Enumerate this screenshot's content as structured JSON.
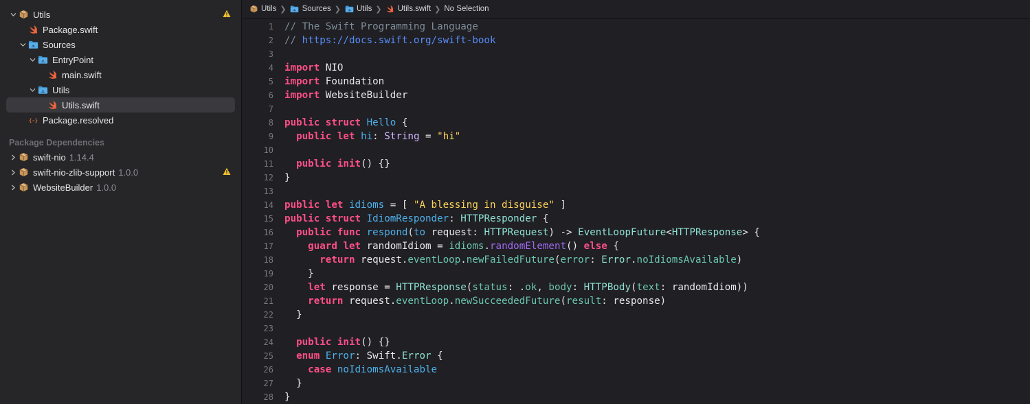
{
  "navigator": {
    "items": [
      {
        "label": "Utils",
        "icon": "package-icon",
        "indent": 0,
        "chevron": "down",
        "warning": true,
        "name": "utils-package"
      },
      {
        "label": "Package.swift",
        "icon": "swift-file-icon",
        "indent": 1,
        "chevron": "none",
        "name": "package-swift-file"
      },
      {
        "label": "Sources",
        "icon": "folder-icon",
        "indent": 1,
        "chevron": "down",
        "name": "sources-folder"
      },
      {
        "label": "EntryPoint",
        "icon": "folder-icon",
        "indent": 2,
        "chevron": "down",
        "name": "entrypoint-folder"
      },
      {
        "label": "main.swift",
        "icon": "swift-file-icon",
        "indent": 3,
        "chevron": "none",
        "name": "main-swift-file"
      },
      {
        "label": "Utils",
        "icon": "folder-icon",
        "indent": 2,
        "chevron": "down",
        "name": "utils-folder"
      },
      {
        "label": "Utils.swift",
        "icon": "swift-file-icon",
        "indent": 3,
        "chevron": "none",
        "selected": true,
        "name": "utils-swift-file"
      },
      {
        "label": "Package.resolved",
        "icon": "resolved-file-icon",
        "indent": 1,
        "chevron": "none",
        "name": "package-resolved-file"
      }
    ],
    "dependencies_header": "Package Dependencies",
    "dependencies": [
      {
        "label": "swift-nio",
        "version": "1.14.4",
        "warning": false
      },
      {
        "label": "swift-nio-zlib-support",
        "version": "1.0.0",
        "warning": true
      },
      {
        "label": "WebsiteBuilder",
        "version": "1.0.0",
        "warning": false
      }
    ]
  },
  "jumpbar": {
    "crumbs": [
      {
        "label": "Utils",
        "icon": "package-icon"
      },
      {
        "label": "Sources",
        "icon": "folder-icon"
      },
      {
        "label": "Utils",
        "icon": "folder-icon"
      },
      {
        "label": "Utils.swift",
        "icon": "swift-file-icon"
      },
      {
        "label": "No Selection",
        "icon": ""
      }
    ],
    "separator": "❯"
  },
  "editor": {
    "lines": [
      [
        [
          "cm",
          "// The Swift Programming Language"
        ]
      ],
      [
        [
          "cm",
          "// "
        ],
        [
          "url",
          "https://docs.swift.org/swift-book"
        ]
      ],
      [],
      [
        [
          "kw",
          "import"
        ],
        [
          "pun",
          " NIO"
        ]
      ],
      [
        [
          "kw",
          "import"
        ],
        [
          "pun",
          " Foundation"
        ]
      ],
      [
        [
          "kw",
          "import"
        ],
        [
          "pun",
          " WebsiteBuilder"
        ]
      ],
      [],
      [
        [
          "kw",
          "public"
        ],
        [
          "pun",
          " "
        ],
        [
          "kw",
          "struct"
        ],
        [
          "pun",
          " "
        ],
        [
          "decl",
          "Hello"
        ],
        [
          "pun",
          " {"
        ]
      ],
      [
        [
          "pun",
          "  "
        ],
        [
          "kw",
          "public"
        ],
        [
          "pun",
          " "
        ],
        [
          "kw",
          "let"
        ],
        [
          "pun",
          " "
        ],
        [
          "decl",
          "hi"
        ],
        [
          "pun",
          ": "
        ],
        [
          "typ",
          "String"
        ],
        [
          "pun",
          " = "
        ],
        [
          "str",
          "\"hi\""
        ]
      ],
      [],
      [
        [
          "pun",
          "  "
        ],
        [
          "kw",
          "public"
        ],
        [
          "pun",
          " "
        ],
        [
          "kw",
          "init"
        ],
        [
          "pun",
          "() {}"
        ]
      ],
      [
        [
          "pun",
          "}"
        ]
      ],
      [],
      [
        [
          "kw",
          "public"
        ],
        [
          "pun",
          " "
        ],
        [
          "kw",
          "let"
        ],
        [
          "pun",
          " "
        ],
        [
          "decl",
          "idioms"
        ],
        [
          "pun",
          " = [ "
        ],
        [
          "str",
          "\"A blessing in disguise\""
        ],
        [
          "pun",
          " ]"
        ]
      ],
      [
        [
          "kw",
          "public"
        ],
        [
          "pun",
          " "
        ],
        [
          "kw",
          "struct"
        ],
        [
          "pun",
          " "
        ],
        [
          "decl",
          "IdiomResponder"
        ],
        [
          "pun",
          ": "
        ],
        [
          "lib",
          "HTTPResponder"
        ],
        [
          "pun",
          " {"
        ]
      ],
      [
        [
          "pun",
          "  "
        ],
        [
          "kw",
          "public"
        ],
        [
          "pun",
          " "
        ],
        [
          "kw",
          "func"
        ],
        [
          "pun",
          " "
        ],
        [
          "decl",
          "respond"
        ],
        [
          "pun",
          "("
        ],
        [
          "decl",
          "to"
        ],
        [
          "pun",
          " request: "
        ],
        [
          "lib",
          "HTTPRequest"
        ],
        [
          "pun",
          ") -> "
        ],
        [
          "lib",
          "EventLoopFuture"
        ],
        [
          "pun",
          "<"
        ],
        [
          "lib",
          "HTTPResponse"
        ],
        [
          "pun",
          "> {"
        ]
      ],
      [
        [
          "pun",
          "    "
        ],
        [
          "kw",
          "guard"
        ],
        [
          "pun",
          " "
        ],
        [
          "kw",
          "let"
        ],
        [
          "pun",
          " randomIdiom = "
        ],
        [
          "mem",
          "idioms"
        ],
        [
          "pun",
          "."
        ],
        [
          "meth",
          "randomElement"
        ],
        [
          "pun",
          "() "
        ],
        [
          "kw",
          "else"
        ],
        [
          "pun",
          " {"
        ]
      ],
      [
        [
          "pun",
          "      "
        ],
        [
          "kw",
          "return"
        ],
        [
          "pun",
          " request."
        ],
        [
          "mem",
          "eventLoop"
        ],
        [
          "pun",
          "."
        ],
        [
          "mem",
          "newFailedFuture"
        ],
        [
          "pun",
          "("
        ],
        [
          "mem",
          "error"
        ],
        [
          "pun",
          ": "
        ],
        [
          "lib",
          "Error"
        ],
        [
          "pun",
          "."
        ],
        [
          "mem",
          "noIdiomsAvailable"
        ],
        [
          "pun",
          ")"
        ]
      ],
      [
        [
          "pun",
          "    }"
        ]
      ],
      [
        [
          "pun",
          "    "
        ],
        [
          "kw",
          "let"
        ],
        [
          "pun",
          " response = "
        ],
        [
          "lib",
          "HTTPResponse"
        ],
        [
          "pun",
          "("
        ],
        [
          "mem",
          "status"
        ],
        [
          "pun",
          ": ."
        ],
        [
          "mem",
          "ok"
        ],
        [
          "pun",
          ", "
        ],
        [
          "mem",
          "body"
        ],
        [
          "pun",
          ": "
        ],
        [
          "lib",
          "HTTPBody"
        ],
        [
          "pun",
          "("
        ],
        [
          "mem",
          "text"
        ],
        [
          "pun",
          ": randomIdiom))"
        ]
      ],
      [
        [
          "pun",
          "    "
        ],
        [
          "kw",
          "return"
        ],
        [
          "pun",
          " request."
        ],
        [
          "mem",
          "eventLoop"
        ],
        [
          "pun",
          "."
        ],
        [
          "mem",
          "newSucceededFuture"
        ],
        [
          "pun",
          "("
        ],
        [
          "mem",
          "result"
        ],
        [
          "pun",
          ": response)"
        ]
      ],
      [
        [
          "pun",
          "  }"
        ]
      ],
      [],
      [
        [
          "pun",
          "  "
        ],
        [
          "kw",
          "public"
        ],
        [
          "pun",
          " "
        ],
        [
          "kw",
          "init"
        ],
        [
          "pun",
          "() {}"
        ]
      ],
      [
        [
          "pun",
          "  "
        ],
        [
          "kw",
          "enum"
        ],
        [
          "pun",
          " "
        ],
        [
          "decl",
          "Error"
        ],
        [
          "pun",
          ": Swift."
        ],
        [
          "lib",
          "Error"
        ],
        [
          "pun",
          " {"
        ]
      ],
      [
        [
          "pun",
          "    "
        ],
        [
          "kw",
          "case"
        ],
        [
          "pun",
          " "
        ],
        [
          "decl",
          "noIdiomsAvailable"
        ]
      ],
      [
        [
          "pun",
          "  }"
        ]
      ],
      [
        [
          "pun",
          "}"
        ]
      ]
    ]
  },
  "colors": {
    "background": "#1f1f24",
    "sidebar": "#262629",
    "keyword": "#ff4f86",
    "string": "#ffd35a",
    "comment": "#7f8c98",
    "url": "#5a8cf6",
    "folder": "#3f97d6",
    "package": "#c8965a",
    "swift": "#f0643c",
    "warning": "#f2c12e"
  }
}
